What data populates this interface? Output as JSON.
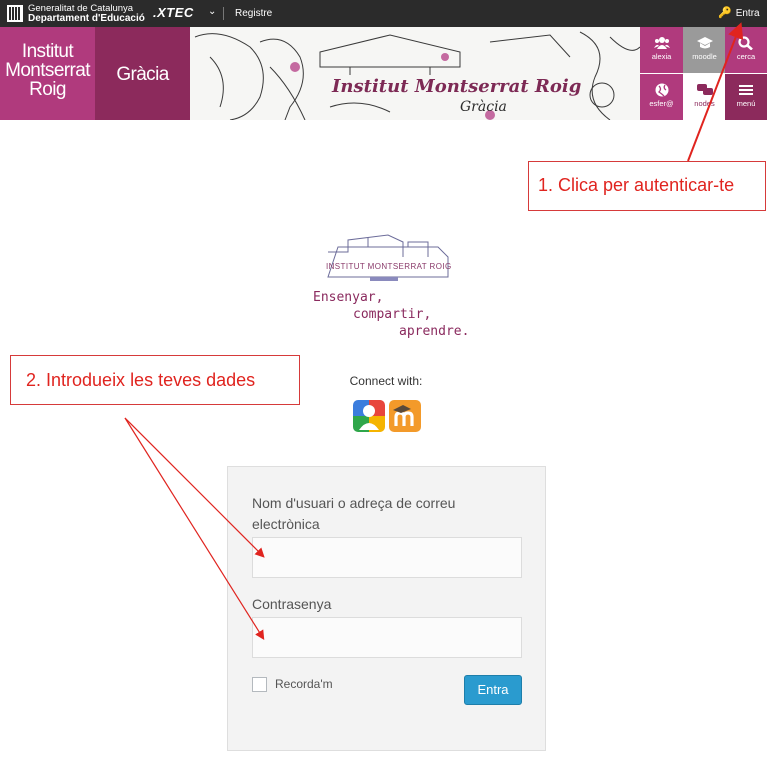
{
  "topbar": {
    "gencat_line1": "Generalitat de Catalunya",
    "gencat_line2": "Departament d'Educació",
    "xtec": ".XTEC",
    "registre": "Registre",
    "entra": "Entra"
  },
  "header": {
    "institute_name": [
      "Institut",
      "Montserrat",
      "Roig"
    ],
    "district": "Gràcia",
    "banner_title": "Institut Montserrat Roig",
    "banner_subtitle": "Gràcia",
    "tiles": [
      {
        "label": "alexia",
        "icon": "users-icon",
        "color": "#b03a7d"
      },
      {
        "label": "moodle",
        "icon": "graduation-cap-icon",
        "color": "#9a9a9a"
      },
      {
        "label": "cerca",
        "icon": "search-icon",
        "color": "#b03a7d"
      },
      {
        "label": "esfer@",
        "icon": "globe-icon",
        "color": "#b03a7d"
      },
      {
        "label": "nodes",
        "icon": "chat-icon",
        "color": "#ffffff"
      },
      {
        "label": "menú",
        "icon": "menu-icon",
        "color": "#8c2a5c"
      }
    ]
  },
  "annotations": {
    "step1": "1. Clica per autenticar-te",
    "step2": "2. Introdueix les teves dades"
  },
  "logo": {
    "name": "INSTITUT MONTSERRAT ROIG",
    "slogan": [
      "Ensenyar,",
      "compartir,",
      "aprendre."
    ]
  },
  "connect": {
    "label": "Connect with:",
    "providers": [
      "google-icon",
      "moodle-icon"
    ]
  },
  "login": {
    "username_label": "Nom d'usuari o adreça de correu electrònica",
    "username_value": "",
    "password_label": "Contrasenya",
    "password_value": "",
    "remember_label": "Recorda'm",
    "remember_checked": false,
    "submit_label": "Entra"
  },
  "colors": {
    "brand": "#b03a7d",
    "brand_dark": "#8c2a5c",
    "annotation": "#e0241f",
    "button": "#2a9bcf"
  }
}
